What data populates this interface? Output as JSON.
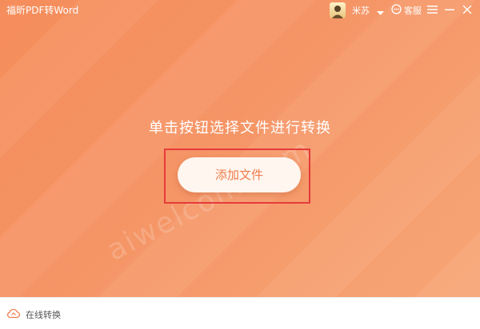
{
  "titlebar": {
    "app_title": "福昕PDF转Word",
    "username": "米苏",
    "support_label": "客服"
  },
  "main": {
    "prompt": "单击按钮选择文件进行转换",
    "add_button_label": "添加文件",
    "watermark": "aiwelcom.com"
  },
  "footer": {
    "online_label": "在线转换"
  },
  "colors": {
    "accent": "#f59566",
    "button_text": "#ef7d4b",
    "highlight": "#e53b3b"
  },
  "icons": {
    "dropdown": "chevron-down-icon",
    "support": "chat-bubble-icon",
    "menu": "hamburger-menu-icon",
    "minimize": "minimize-icon",
    "close": "close-icon",
    "online": "cloud-icon"
  }
}
